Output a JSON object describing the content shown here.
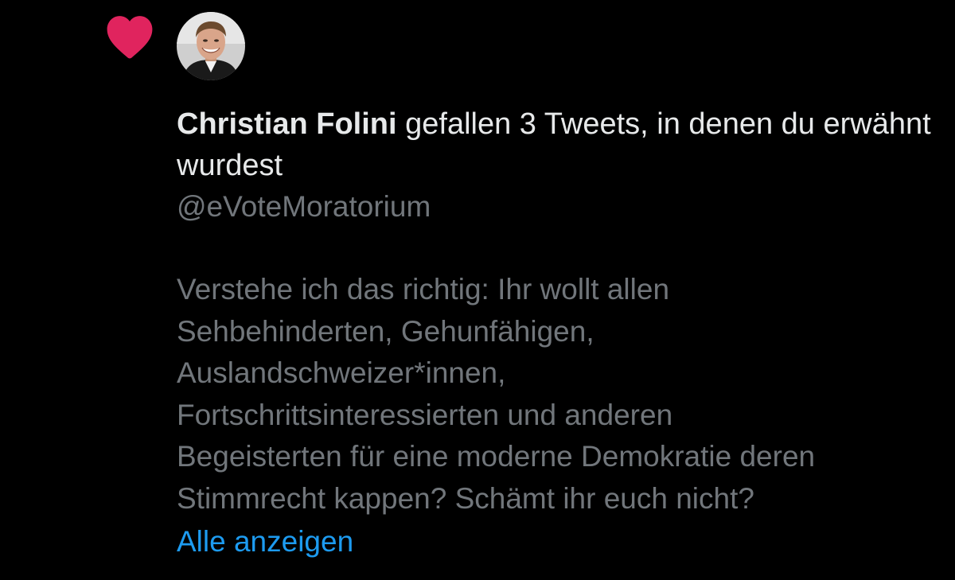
{
  "notification": {
    "icon": "heart-icon",
    "icon_color": "#E0245E",
    "actor_name": "Christian Folini",
    "action_text": " gefallen 3 Tweets, in denen du erwähnt wurdest",
    "handle": "@eVoteMoratorium",
    "tweet_lines": [
      "Verstehe ich das richtig: Ihr wollt allen",
      "Sehbehinderten, Gehunfähigen,",
      "Auslandschweizer*innen,",
      "Fortschrittsinteressierten und anderen",
      "Begeisterten für eine moderne Demokratie deren",
      "Stimmrecht kappen? Schämt ihr euch nicht?"
    ],
    "show_all_label": "Alle anzeigen"
  },
  "colors": {
    "background": "#000000",
    "primary_text": "#E7E9EA",
    "secondary_text": "#71767B",
    "link": "#1D9BF0"
  }
}
